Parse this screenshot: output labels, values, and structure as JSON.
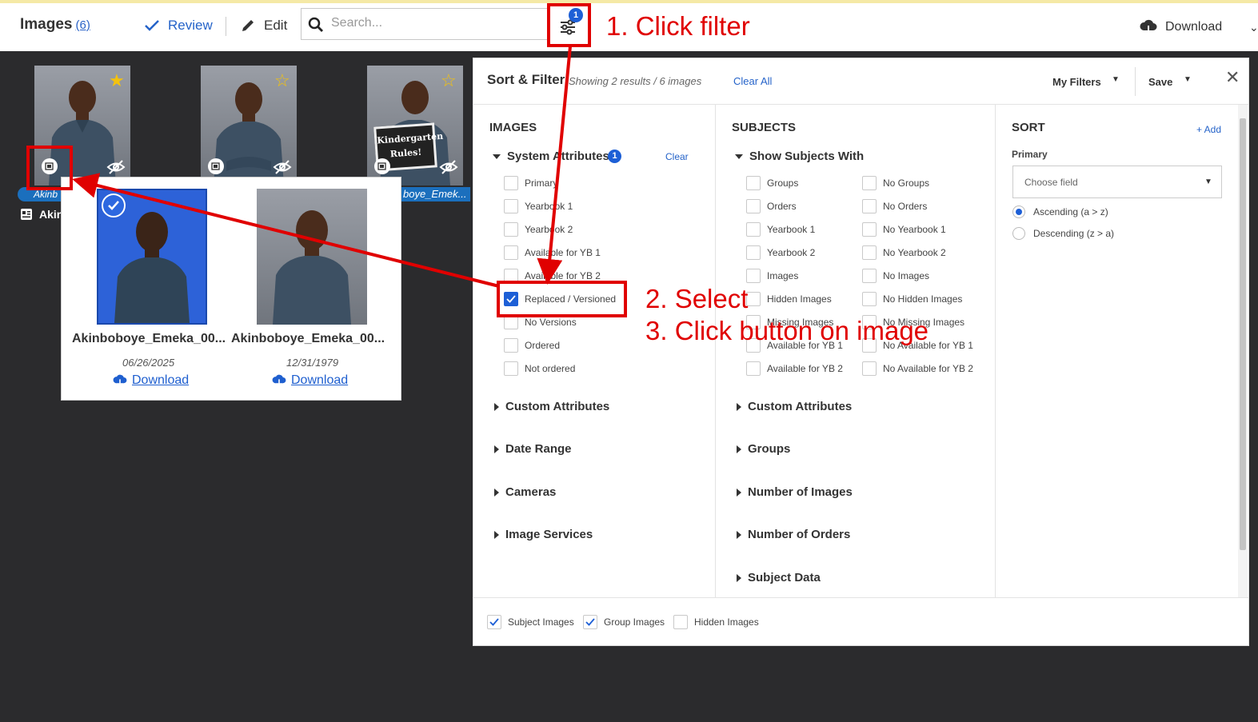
{
  "header": {
    "title": "Images",
    "count": "(6)",
    "review_label": "Review",
    "edit_label": "Edit",
    "search_placeholder": "Search...",
    "filter_badge": "1",
    "download_label": "Download"
  },
  "annotations": {
    "step1": "1. Click filter",
    "step2": "2. Select",
    "step3": "3. Click button on image"
  },
  "gallery": {
    "label1": "Akinb",
    "label3": "boye_Emek...",
    "subject_name": "Akin",
    "sign_text": "Kindergarten Rules!"
  },
  "versions": [
    {
      "name": "Akinboboye_Emeka_00...",
      "date": "06/26/2025",
      "download": "Download"
    },
    {
      "name": "Akinboboye_Emeka_00...",
      "date": "12/31/1979",
      "download": "Download"
    }
  ],
  "sort_filter": {
    "title": "Sort & Filter",
    "showing": "Showing 2 results / 6 images",
    "clear_all": "Clear All",
    "my_filters": "My Filters",
    "save": "Save",
    "images": {
      "heading": "IMAGES",
      "system_attributes": "System Attributes",
      "badge": "1",
      "clear": "Clear",
      "options": [
        "Primary",
        "Yearbook 1",
        "Yearbook 2",
        "Available for YB 1",
        "Available for YB 2",
        "Replaced / Versioned",
        "No Versions",
        "Ordered",
        "Not ordered"
      ],
      "groups": [
        "Custom Attributes",
        "Date Range",
        "Cameras",
        "Image Services"
      ]
    },
    "subjects": {
      "heading": "SUBJECTS",
      "show_with": "Show Subjects With",
      "left_options": [
        "Groups",
        "Orders",
        "Yearbook 1",
        "Yearbook 2",
        "Images",
        "Hidden Images",
        "Missing Images",
        "Available for YB 1",
        "Available for YB 2"
      ],
      "right_options": [
        "No Groups",
        "No Orders",
        "No Yearbook 1",
        "No Yearbook 2",
        "No Images",
        "No Hidden Images",
        "No Missing Images",
        "No Available for YB 1",
        "No Available for YB 2"
      ],
      "groups": [
        "Custom Attributes",
        "Groups",
        "Number of Images",
        "Number of Orders",
        "Subject Data"
      ]
    },
    "sort": {
      "heading": "SORT",
      "add": "+ Add",
      "primary_label": "Primary",
      "select_placeholder": "Choose field",
      "ascending": "Ascending (a > z)",
      "descending": "Descending (z > a)"
    },
    "footer": {
      "subject_images": "Subject Images",
      "group_images": "Group Images",
      "hidden_images": "Hidden Images"
    }
  },
  "colors": {
    "accent": "#1d5fd6",
    "annotation": "#e00000",
    "star": "#f4c20d",
    "background": "#2b2b2d"
  }
}
